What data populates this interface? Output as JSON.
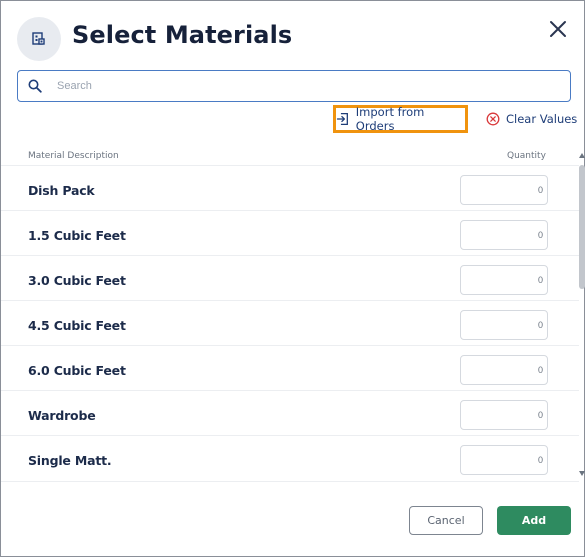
{
  "dialog": {
    "title": "Select Materials",
    "header_icon": "materials-grid-icon",
    "close_icon": "close-icon"
  },
  "search": {
    "placeholder": "Search",
    "value": "",
    "icon": "search-icon"
  },
  "actions": {
    "import_label": "Import from Orders",
    "import_icon": "import-icon",
    "clear_label": "Clear Values",
    "clear_icon": "clear-circle-x-icon",
    "colors": {
      "highlight": "#f0930e",
      "link": "#1e3d78",
      "clear_icon": "#d9393b"
    }
  },
  "table": {
    "headers": {
      "description": "Material Description",
      "quantity": "Quantity"
    },
    "rows": [
      {
        "name": "Dish Pack",
        "qty": "0"
      },
      {
        "name": "1.5 Cubic Feet",
        "qty": "0"
      },
      {
        "name": "3.0 Cubic Feet",
        "qty": "0"
      },
      {
        "name": "4.5 Cubic Feet",
        "qty": "0"
      },
      {
        "name": "6.0 Cubic Feet",
        "qty": "0"
      },
      {
        "name": "Wardrobe",
        "qty": "0"
      },
      {
        "name": "Single Matt.",
        "qty": "0"
      }
    ]
  },
  "footer": {
    "cancel_label": "Cancel",
    "add_label": "Add",
    "add_color": "#2e8b60"
  }
}
